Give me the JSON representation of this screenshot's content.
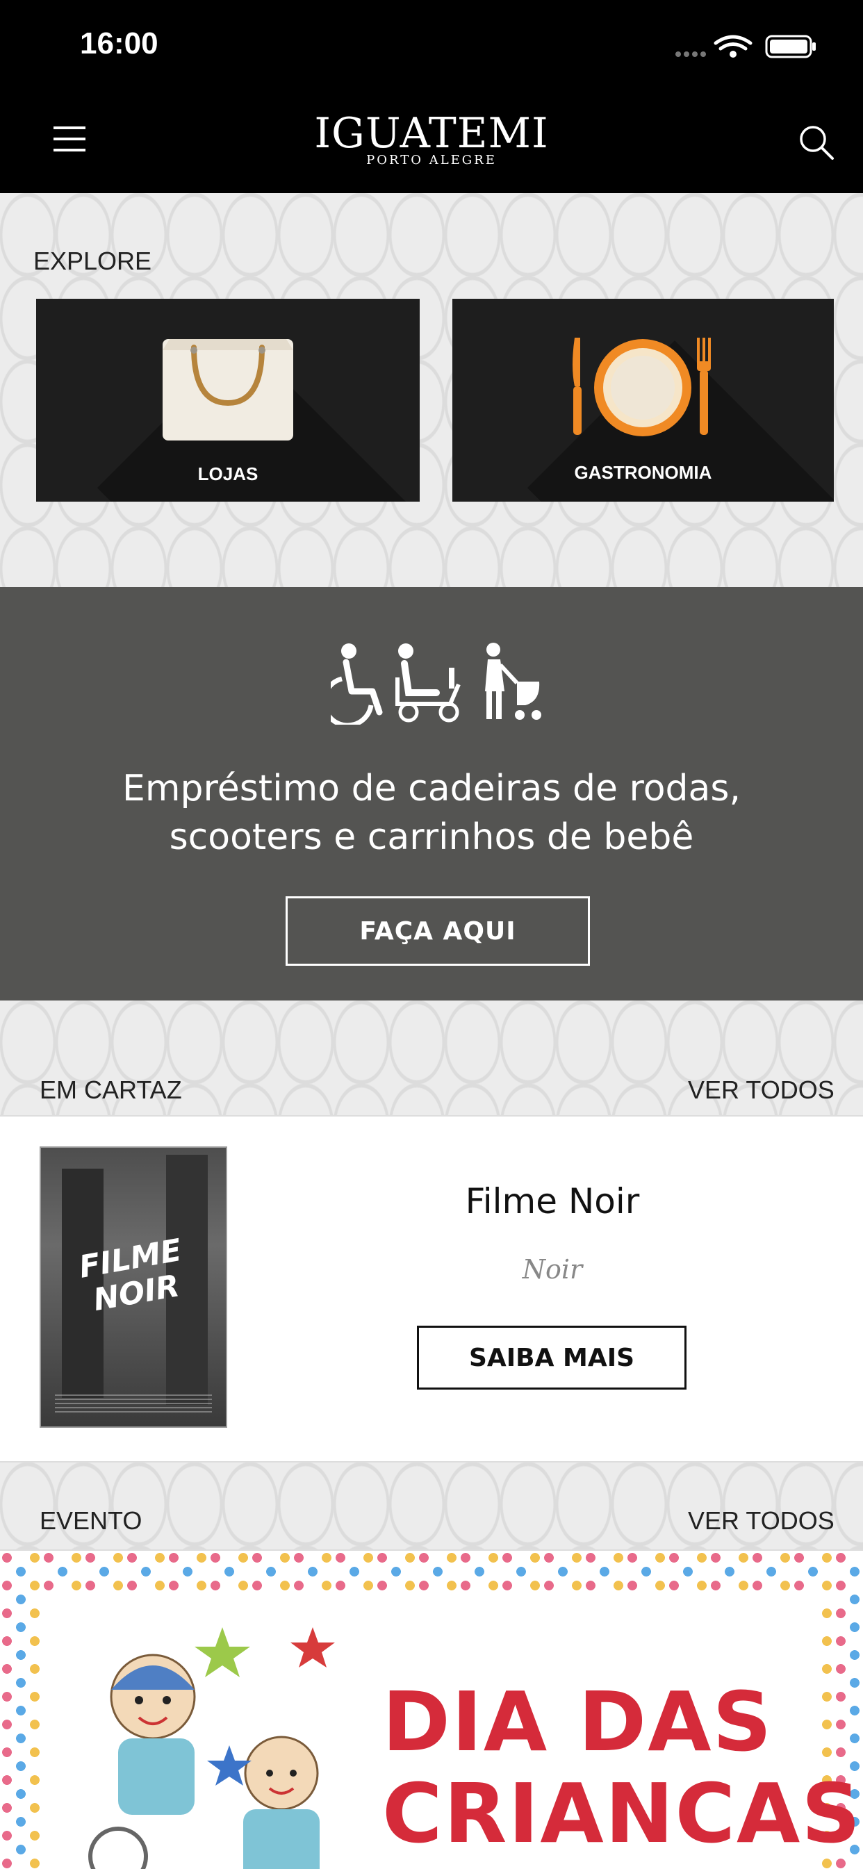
{
  "status_bar": {
    "time": "16:00"
  },
  "header": {
    "brand": "IGUATEMI",
    "brand_sub": "PORTO ALEGRE",
    "menu_icon": "hamburger-menu-icon",
    "search_icon": "search-icon"
  },
  "explore": {
    "title": "EXPLORE",
    "tiles": [
      {
        "label": "LOJAS",
        "icon": "shopping-bag-icon"
      },
      {
        "label": "GASTRONOMIA",
        "icon": "plate-cutlery-icon"
      }
    ]
  },
  "accessibility": {
    "icons": [
      "wheelchair-icon",
      "scooter-icon",
      "stroller-icon"
    ],
    "line1": "Empréstimo de cadeiras de rodas,",
    "line2": "scooters e carrinhos de bebê",
    "button": "FAÇA AQUI"
  },
  "em_cartaz": {
    "title": "EM CARTAZ",
    "see_all": "VER TODOS",
    "movie": {
      "poster_title": "FILME NOIR",
      "title": "Filme Noir",
      "genre": "Noir",
      "button": "SAIBA MAIS"
    }
  },
  "evento": {
    "title": "EVENTO",
    "see_all": "VER TODOS",
    "banner_line1": "DIA DAS",
    "banner_line2": "CRIANCAS"
  },
  "colors": {
    "header_bg": "#000000",
    "banner_bg": "#545452",
    "event_red": "#d52b3a",
    "plate_orange": "#f08a24"
  }
}
